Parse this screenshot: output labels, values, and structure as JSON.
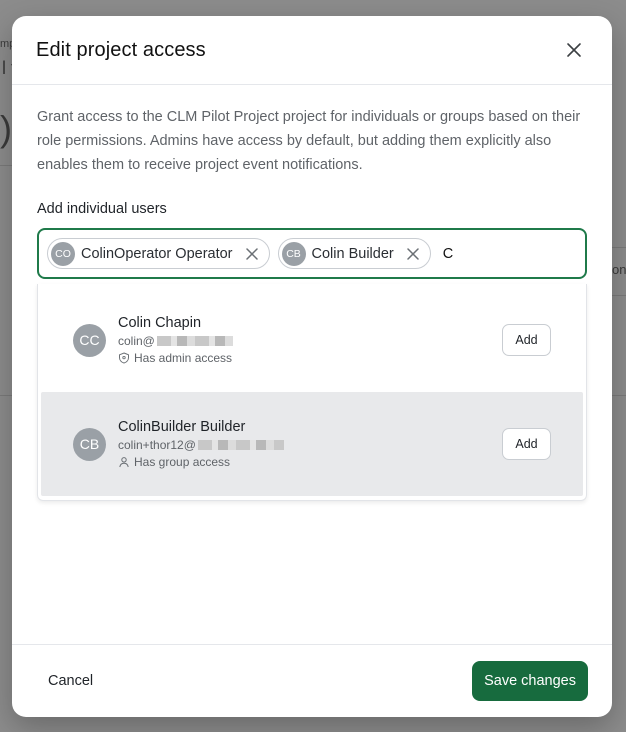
{
  "modal": {
    "title": "Edit project access",
    "description": "Grant access to the CLM Pilot Project project for individuals or groups based on their role permissions. Admins have access by default, but adding them explicitly also enables them to receive project event notifications.",
    "field_label": "Add individual users",
    "chips": [
      {
        "initials": "CO",
        "label": "ColinOperator Operator"
      },
      {
        "initials": "CB",
        "label": "Colin Builder"
      }
    ],
    "search_value": "C",
    "options": [
      {
        "initials": "CC",
        "name": "Colin Chapin",
        "email_prefix": "colin@",
        "access": "Has admin access",
        "access_icon": "shield-icon",
        "add_label": "Add"
      },
      {
        "initials": "CB",
        "name": "ColinBuilder Builder",
        "email_prefix": "colin+thor12@",
        "access": "Has group access",
        "access_icon": "person-icon",
        "add_label": "Add"
      }
    ],
    "cancel_label": "Cancel",
    "save_label": "Save changes"
  },
  "colors": {
    "primary": "#176b3e",
    "focus_border": "#1f7a4a",
    "highlight_row": "#e8e9eb"
  }
}
